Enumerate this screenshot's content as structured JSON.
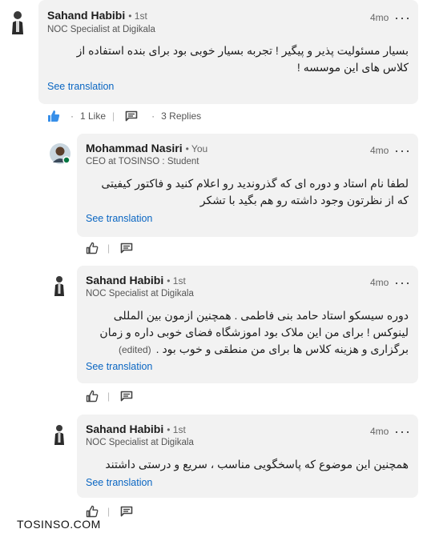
{
  "comments": [
    {
      "author": "Sahand Habibi",
      "degree": "• 1st",
      "headline": "NOC Specialist at Digikala",
      "time": "4mo",
      "more": "···",
      "text_line1": "بسیار مسئولیت پذیر و پیگیر ! تجربه بسیار خوبی بود برای بنده استفاده از",
      "text_line2": "کلاس های این موسسه !",
      "see_translation": "See translation",
      "like_count": "1 Like",
      "replies_count": "3 Replies",
      "sep": "·"
    }
  ],
  "replies": [
    {
      "author": "Mohammad Nasiri",
      "degree": "• You",
      "headline": "CEO at TOSINSO : Student",
      "time": "4mo",
      "more": "···",
      "text_line1": "لطفا نام استاد و دوره ای که گذروندید رو اعلام کنید و فاکتور کیفیتی",
      "text_line2": "که از نظرتون وجود داشته رو هم بگید با تشکر",
      "see_translation": "See translation"
    },
    {
      "author": "Sahand Habibi",
      "degree": "• 1st",
      "headline": "NOC Specialist at Digikala",
      "time": "4mo",
      "more": "···",
      "text_line1": "دوره سیسکو استاد حامد بنی فاطمی . همچنین ازمون بین المللی",
      "text_line2": "لینوکس ! برای من این ملاک بود اموزشگاه فضای خوبی داره و زمان",
      "text_line3": "برگزاری و  هزینه  کلاس ها برای من منطقی و خوب بود .",
      "edited": "(edited)",
      "see_translation": "See translation"
    },
    {
      "author": "Sahand Habibi",
      "degree": "• 1st",
      "headline": "NOC Specialist at Digikala",
      "time": "4mo",
      "more": "···",
      "text_line1": "همچنین این موضوع که پاسخگویی مناسب ، سریع و درستی داشتند",
      "see_translation": "See translation"
    }
  ],
  "watermark": "TOSINSO.COM",
  "colors": {
    "link": "#0a66c2",
    "bubble": "#f2f2f2",
    "online": "#057642"
  },
  "icons": [
    "like-icon-filled",
    "like-icon",
    "comment-icon",
    "more-icon"
  ]
}
